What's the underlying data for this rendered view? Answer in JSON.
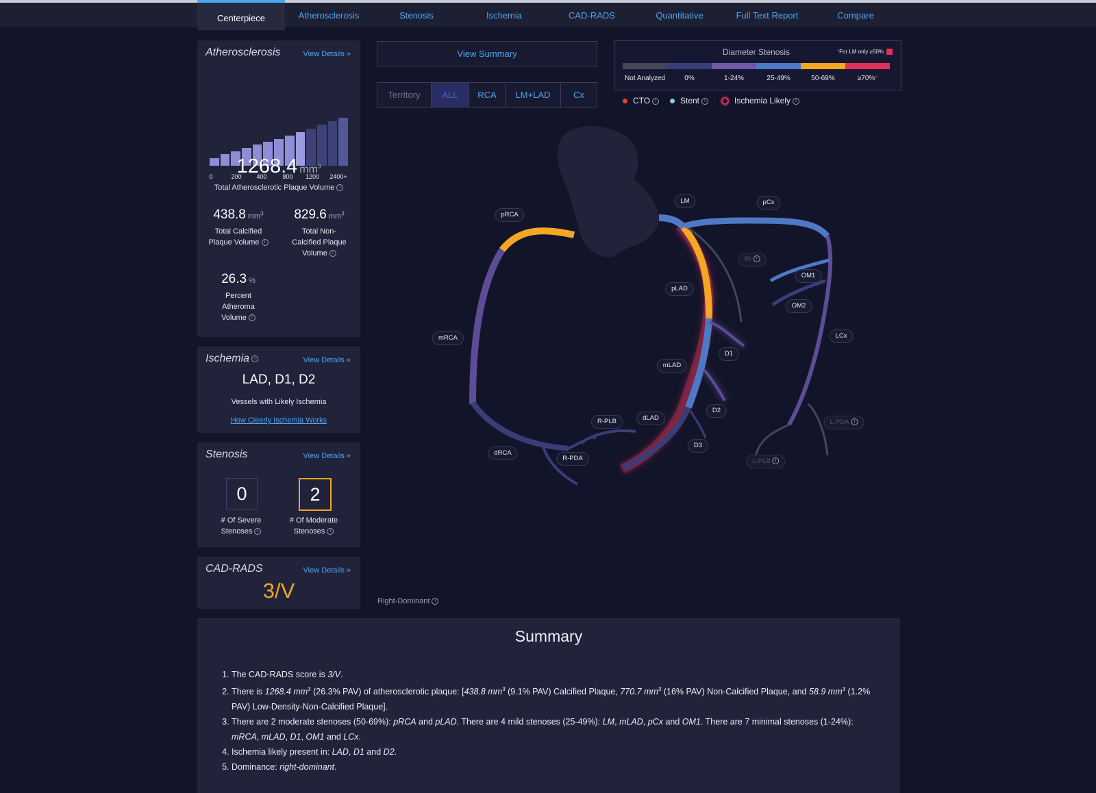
{
  "nav": {
    "tabs": [
      {
        "label": "Centerpiece",
        "active": true
      },
      {
        "label": "Atherosclerosis"
      },
      {
        "label": "Stenosis"
      },
      {
        "label": "Ischemia"
      },
      {
        "label": "CAD-RADS"
      },
      {
        "label": "Quantitative"
      },
      {
        "label": "Full Text Report"
      },
      {
        "label": "Compare"
      }
    ]
  },
  "atherosclerosis": {
    "title": "Atherosclerosis",
    "view_details": "View Details",
    "histogram": {
      "ticks": [
        "0",
        "200",
        "400",
        "800",
        "1200",
        "2400+"
      ],
      "bars": [
        0.15,
        0.24,
        0.3,
        0.37,
        0.44,
        0.5,
        0.56,
        0.63,
        0.7,
        0.77,
        0.85,
        0.92,
        1.0
      ],
      "highlight_from": 8
    },
    "total_value": "1268.4",
    "total_unit": "mm",
    "total_label": "Total Atherosclerotic Plaque Volume",
    "calcified_value": "438.8",
    "calcified_unit": "mm",
    "calcified_label_1": "Total Calcified",
    "calcified_label_2": "Plaque Volume",
    "noncalcified_value": "829.6",
    "noncalcified_unit": "mm",
    "noncalcified_label_1": "Total Non-",
    "noncalcified_label_2": "Calcified Plaque",
    "noncalcified_label_3": "Volume",
    "pav_value": "26.3",
    "pav_unit": "%",
    "pav_label_1": "Percent",
    "pav_label_2": "Atheroma",
    "pav_label_3": "Volume"
  },
  "ischemia": {
    "title": "Ischemia",
    "view_details": "View Details",
    "vessels": "LAD, D1, D2",
    "label": "Vessels with Likely Ischemia",
    "link": "How Cleerly Ischemia Works"
  },
  "stenosis": {
    "title": "Stenosis",
    "view_details": "View Details",
    "severe_count": "0",
    "severe_label_1": "# Of Severe",
    "severe_label_2": "Stenoses",
    "moderate_count": "2",
    "moderate_label_1": "# Of Moderate",
    "moderate_label_2": "Stenoses"
  },
  "cadrads": {
    "title": "CAD-RADS",
    "view_details": "View Details",
    "score": "3/V"
  },
  "controls": {
    "view_summary": "View Summary",
    "territory_label": "Territory",
    "territories": [
      "ALL",
      "RCA",
      "LM+LAD",
      "Cx"
    ],
    "dominance": "Right-Dominant"
  },
  "legend": {
    "title": "Diameter Stenosis",
    "note_star": "*",
    "note": "For LM only ≥50%",
    "categories": [
      {
        "label": "Not Analyzed",
        "color": "#44475a"
      },
      {
        "label": "0%",
        "color": "#3a3d78"
      },
      {
        "label": "1-24%",
        "color": "#6f58a8"
      },
      {
        "label": "25-49%",
        "color": "#4e79c6"
      },
      {
        "label": "50-69%",
        "color": "#f5a623"
      },
      {
        "label": "≥70%",
        "color": "#e0315b"
      }
    ],
    "lm_color": "#e0315b"
  },
  "status_legend": {
    "cto": "CTO",
    "stent": "Stent",
    "ischemia": "Ischemia Likely",
    "cto_color": "#e8452e",
    "stent_color": "#7fd3e8",
    "ischemia_color": "#e0315b"
  },
  "vessels": {
    "pRCA": "pRCA",
    "mRCA": "mRCA",
    "dRCA": "dRCA",
    "R-PDA": "R-PDA",
    "R-PLB": "R-PLB",
    "LM": "LM",
    "pCx": "pCx",
    "RI": "RI",
    "OM1": "OM1",
    "OM2": "OM2",
    "LCx": "LCx",
    "pLAD": "pLAD",
    "mLAD": "mLAD",
    "dLAD": "dLAD",
    "D1": "D1",
    "D2": "D2",
    "D3": "D3",
    "L-PDA": "L-PDA",
    "L-PLB": "L-PLB"
  },
  "summary": {
    "title": "Summary",
    "items": [
      {
        "parts": [
          [
            "t",
            "The CAD-RADS score is "
          ],
          [
            "i",
            "3/V"
          ],
          [
            "t",
            "."
          ]
        ]
      },
      {
        "parts": [
          [
            "t",
            "There is "
          ],
          [
            "i",
            "1268.4 mm"
          ],
          [
            "s",
            "3"
          ],
          [
            "t",
            " (26.3% PAV) of atherosclerotic plaque: ["
          ],
          [
            "i",
            "438.8 mm"
          ],
          [
            "s",
            "3"
          ],
          [
            "t",
            " (9.1% PAV) Calcified Plaque, "
          ],
          [
            "i",
            "770.7 mm"
          ],
          [
            "s",
            "3"
          ],
          [
            "t",
            " (16% PAV) Non-Calcified Plaque, and "
          ],
          [
            "i",
            "58.9 mm"
          ],
          [
            "s",
            "3"
          ],
          [
            "t",
            " (1.2% PAV) Low-Density-Non-Calcified Plaque]."
          ]
        ]
      },
      {
        "parts": [
          [
            "t",
            "There are 2 moderate stenoses (50-69%): "
          ],
          [
            "i",
            "pRCA"
          ],
          [
            "t",
            " and "
          ],
          [
            "i",
            "pLAD"
          ],
          [
            "t",
            ". There are 4 mild stenoses (25-49%): "
          ],
          [
            "i",
            "LM"
          ],
          [
            "t",
            ", "
          ],
          [
            "i",
            "mLAD"
          ],
          [
            "t",
            ", "
          ],
          [
            "i",
            "pCx"
          ],
          [
            "t",
            " and "
          ],
          [
            "i",
            "OM1"
          ],
          [
            "t",
            ". There are 7 minimal stenoses (1-24%): "
          ],
          [
            "i",
            "mRCA"
          ],
          [
            "t",
            ", "
          ],
          [
            "i",
            "mLAD"
          ],
          [
            "t",
            ", "
          ],
          [
            "i",
            "D1"
          ],
          [
            "t",
            ", "
          ],
          [
            "i",
            "OM1"
          ],
          [
            "t",
            " and "
          ],
          [
            "i",
            "LCx"
          ],
          [
            "t",
            "."
          ]
        ]
      },
      {
        "parts": [
          [
            "t",
            "Ischemia likely present in: "
          ],
          [
            "i",
            "LAD"
          ],
          [
            "t",
            ", "
          ],
          [
            "i",
            "D1"
          ],
          [
            "t",
            " and "
          ],
          [
            "i",
            "D2"
          ],
          [
            "t",
            "."
          ]
        ]
      },
      {
        "parts": [
          [
            "t",
            "Dominance: "
          ],
          [
            "i",
            "right-dominant"
          ],
          [
            "t",
            "."
          ]
        ]
      }
    ]
  }
}
